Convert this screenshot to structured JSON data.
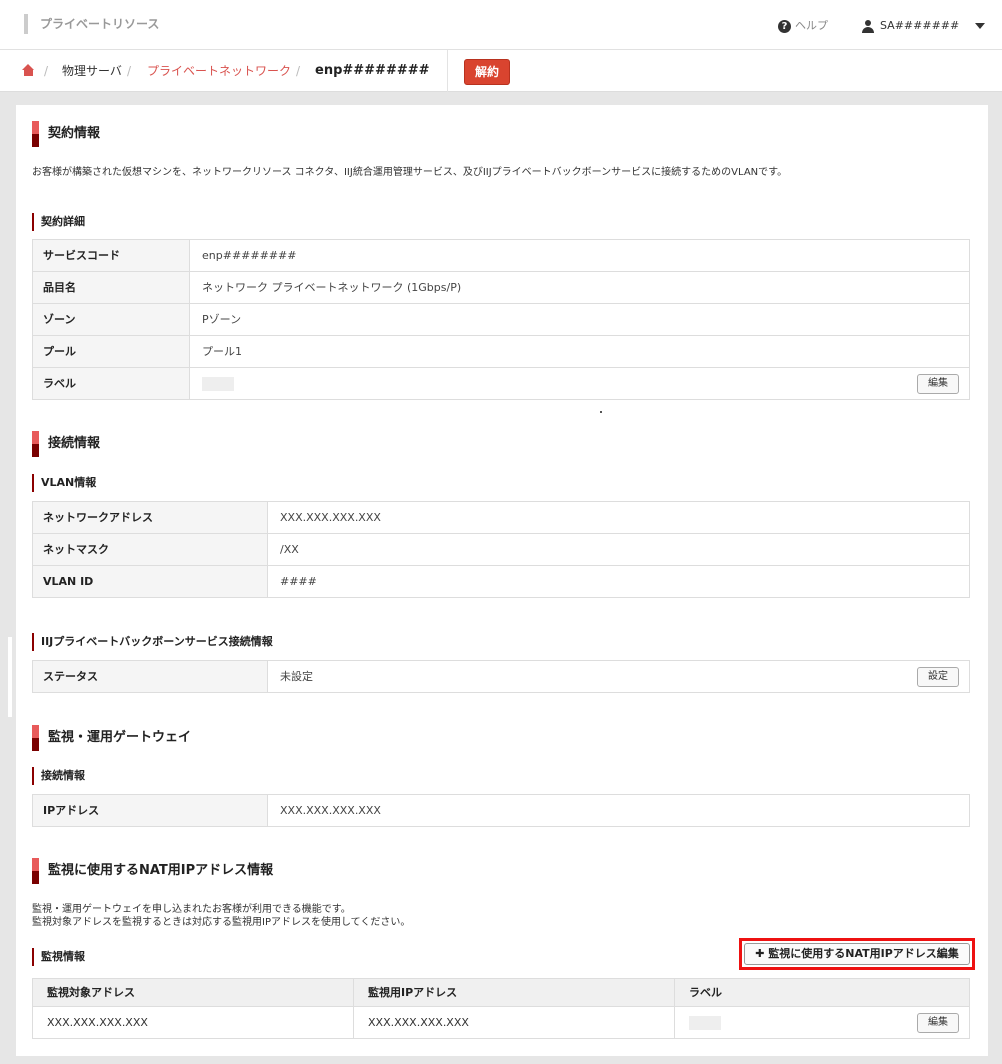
{
  "header": {
    "brand": "プライベートリソース",
    "help": "ヘルプ",
    "user": "SA#######"
  },
  "breadcrumb": {
    "sep": "/",
    "item1": "物理サーバ",
    "item2": "プライベートネットワーク",
    "current": "enp########",
    "cancel": "解約"
  },
  "contract": {
    "title": "契約情報",
    "desc": "お客様が構築された仮想マシンを、ネットワークリソース コネクタ、IIJ統合運用管理サービス、及びIIJプライベートバックボーンサービスに接続するためのVLANです。",
    "detail_title": "契約詳細",
    "rows": [
      {
        "label": "サービスコード",
        "value": "enp########"
      },
      {
        "label": "品目名",
        "value": "ネットワーク プライベートネットワーク (1Gbps/P)"
      },
      {
        "label": "ゾーン",
        "value": "Pゾーン"
      },
      {
        "label": "プール",
        "value": "プール1"
      },
      {
        "label": "ラベル",
        "value": ""
      }
    ],
    "edit": "編集"
  },
  "connection": {
    "title": "接続情報",
    "vlan_title": "VLAN情報",
    "vlan_rows": [
      {
        "label": "ネットワークアドレス",
        "value": "XXX.XXX.XXX.XXX"
      },
      {
        "label": "ネットマスク",
        "value": "/XX"
      },
      {
        "label": "VLAN ID",
        "value": "####"
      }
    ],
    "backbone_title": "IIJプライベートバックボーンサービス接続情報",
    "status_label": "ステータス",
    "status_value": "未設定",
    "setting": "設定"
  },
  "gateway": {
    "title": "監視・運用ゲートウェイ",
    "conn_title": "接続情報",
    "ip_label": "IPアドレス",
    "ip_value": "XXX.XXX.XXX.XXX"
  },
  "nat": {
    "title": "監視に使用するNAT用IPアドレス情報",
    "desc1": "監視・運用ゲートウェイを申し込まれたお客様が利用できる機能です。",
    "desc2": "監視対象アドレスを監視するときは対応する監視用IPアドレスを使用してください。",
    "monitor_title": "監視情報",
    "edit_button": "監視に使用するNAT用IPアドレス編集",
    "headers": [
      "監視対象アドレス",
      "監視用IPアドレス",
      "ラベル"
    ],
    "row": {
      "target": "XXX.XXX.XXX.XXX",
      "monitor_ip": "XXX.XXX.XXX.XXX"
    },
    "edit": "編集"
  }
}
